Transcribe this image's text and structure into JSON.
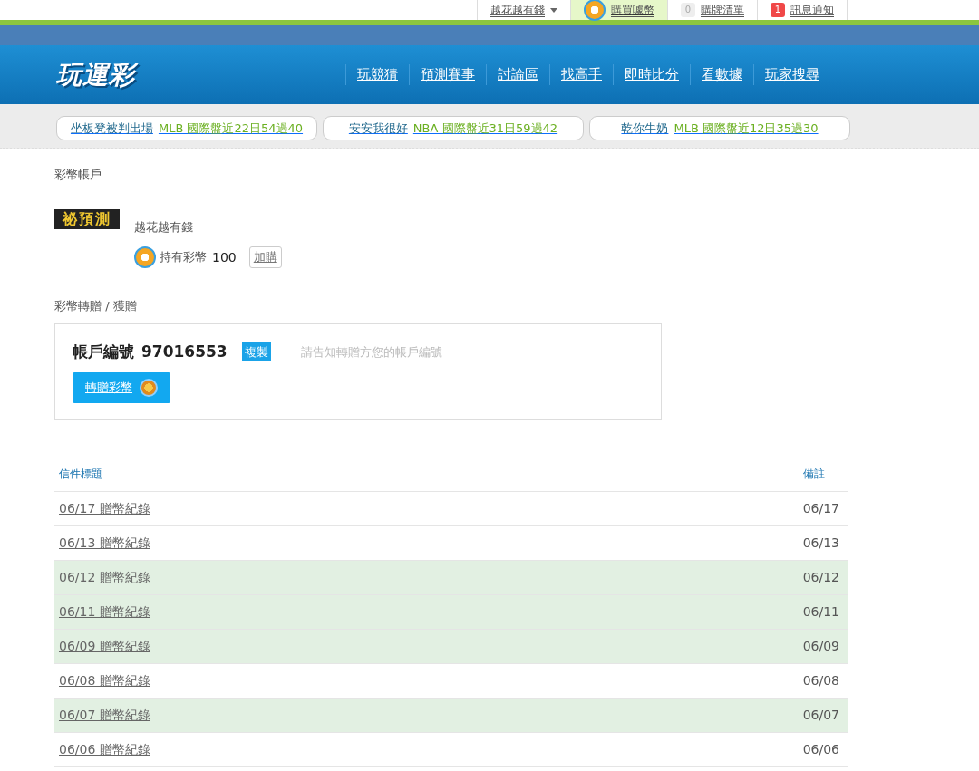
{
  "user_menu": [
    {
      "kind": "dropdown",
      "label": "越花越有錢"
    },
    {
      "kind": "coin",
      "label": "購買噱幣"
    },
    {
      "kind": "count",
      "count": "0",
      "label": "購牌清單",
      "alert": false
    },
    {
      "kind": "count",
      "count": "1",
      "label": "訊息通知",
      "alert": true
    }
  ],
  "logo": "玩運彩",
  "nav": [
    "玩競猜",
    "預測賽事",
    "討論區",
    "找高手",
    "即時比分",
    "看數據",
    "玩家搜尋"
  ],
  "tickers": [
    {
      "name": "坐板凳被判出場",
      "league": "MLB",
      "record": "國際盤近22日54過40"
    },
    {
      "name": "安安我很好",
      "league": "NBA",
      "record": "國際盤近31日59過42"
    },
    {
      "name": "乾你牛奶",
      "league": "MLB",
      "record": "國際盤近12日35過30"
    }
  ],
  "account": {
    "title": "彩幣帳戶",
    "avatar_text": "祕預測",
    "username": "越花越有錢",
    "balance_label": "持有彩幣",
    "balance": "100",
    "buy_button": "加購"
  },
  "transfer": {
    "title": "彩幣轉贈 / 獲贈",
    "account_label": "帳戶編號",
    "account_number": "97016553",
    "copy_button": "複製",
    "hint": "請告知轉贈方您的帳戶編號",
    "transfer_button": "轉贈彩幣"
  },
  "table": {
    "columns": [
      "信件標題",
      "備註"
    ],
    "rows": [
      {
        "title": "06/17 贈幣紀錄",
        "note": "06/17",
        "highlighted": false
      },
      {
        "title": "06/13 贈幣紀錄",
        "note": "06/13",
        "highlighted": false
      },
      {
        "title": "06/12 贈幣紀錄",
        "note": "06/12",
        "highlighted": true
      },
      {
        "title": "06/11 贈幣紀錄",
        "note": "06/11",
        "highlighted": true
      },
      {
        "title": "06/09 贈幣紀錄",
        "note": "06/09",
        "highlighted": true
      },
      {
        "title": "06/08 贈幣紀錄",
        "note": "06/08",
        "highlighted": false
      },
      {
        "title": "06/07 贈幣紀錄",
        "note": "06/07",
        "highlighted": true
      },
      {
        "title": "06/06 贈幣紀錄",
        "note": "06/06",
        "highlighted": false
      }
    ]
  }
}
